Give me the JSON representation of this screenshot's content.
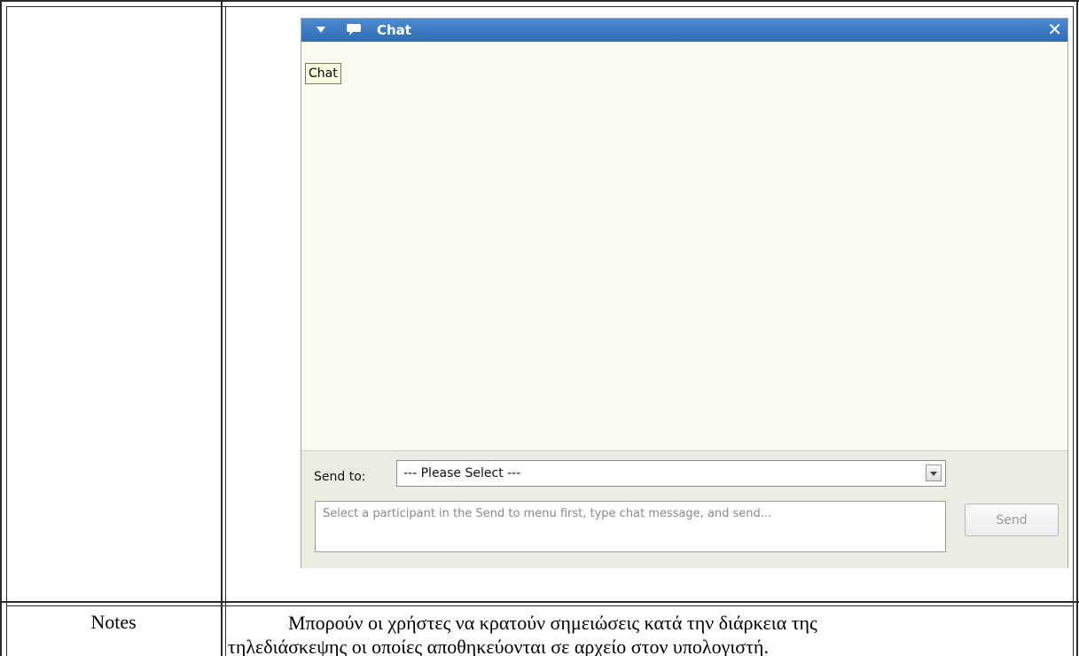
{
  "chat_panel": {
    "title": "Chat",
    "tooltip": "Chat",
    "send_to_label": "Send to:",
    "recipient_select_value": "--- Please Select ---",
    "message_placeholder": "Select a participant in the Send to menu first, type chat message, and send...",
    "send_button_label": "Send",
    "close_glyph": "✕"
  },
  "document": {
    "row_label": "Notes",
    "description_line1": "Μπορούν οι χρήστες να κρατούν σημειώσεις κατά την διάρκεια της",
    "description_line2": "τηλεδιάσκεψης οι οποίες αποθηκεύονται σε αρχείο στον υπολογιστή."
  },
  "colors": {
    "titlebar": "#2e6cb5",
    "panel_background": "#fbfbf1",
    "tooltip_background": "#ffffe1"
  }
}
